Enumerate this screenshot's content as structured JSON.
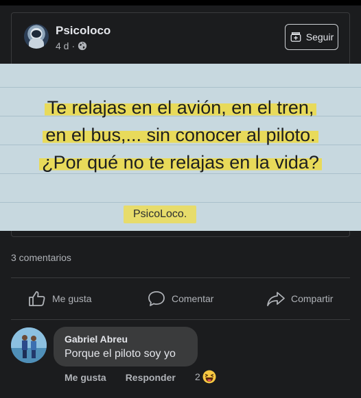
{
  "post": {
    "page_name": "Psicoloco",
    "time": "4 d",
    "separator": "·",
    "privacy_icon": "globe-icon",
    "follow_label": "Seguir",
    "follow_icon": "follow-page-icon"
  },
  "image": {
    "quote_lines": [
      "Te relajas en el avión, en el tren,",
      "en el bus,... sin conocer al piloto.",
      "¿Por qué no te relajas en la vida?"
    ],
    "signature": "PsicoLoco."
  },
  "stats": {
    "comments": "3 comentarios"
  },
  "actions": {
    "like_label": "Me gusta",
    "comment_label": "Comentar",
    "share_label": "Compartir"
  },
  "comment": {
    "author": "Gabriel Abreu",
    "text": "Porque el piloto soy yo",
    "like_label": "Me gusta",
    "reply_label": "Responder",
    "reaction_count": "2",
    "reaction_icon": "haha-emoji-icon"
  },
  "colors": {
    "background": "#1b1c1e",
    "highlight": "#e8da5a",
    "image_bg": "#c7d8df",
    "bubble": "#3a3b3c"
  }
}
